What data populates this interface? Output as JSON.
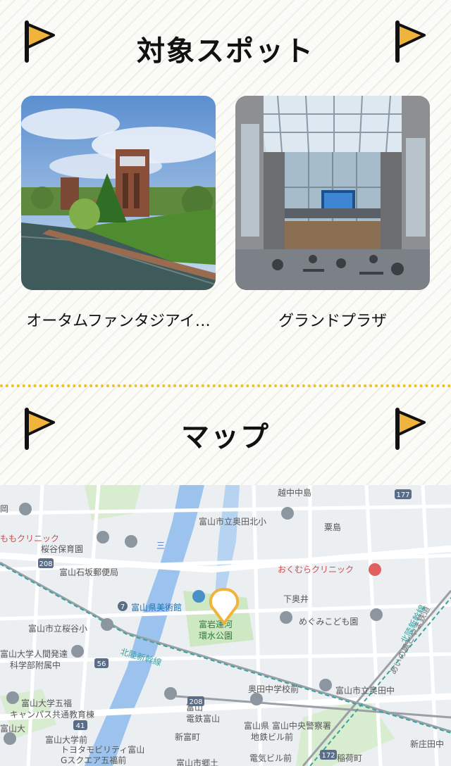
{
  "spots_section": {
    "title": "対象スポット"
  },
  "spots": [
    {
      "name": "オータムファンタジアイ…",
      "photo": "park-tower-canal"
    },
    {
      "name": "グランドプラザ",
      "photo": "glass-atrium-plaza"
    }
  ],
  "map_section": {
    "title": "マップ"
  },
  "map": {
    "pin_color": "#f0b43c",
    "labels": {
      "kosshi_nakajima": "越中中島",
      "toyama_okuda_kita_sho": "富山市立奥田北小",
      "awashima": "粟島",
      "momo_clinic": "ももクリニック",
      "sakuradani_hoikuen": "桜谷保育園",
      "okumura_clinic": "おくむらクリニック",
      "ishizakaguchi_post": "富山石坂郵便局",
      "toyama_art_museum": "富山県美術館",
      "shimo_okui": "下奥井",
      "fugan_canal": "富岩運河",
      "kansui_park": "環水公園",
      "megumi_kodomoen": "めぐみこども園",
      "sakuradani_sho": "富山市立桜谷小",
      "ningen_hattatsu": "富山大学人間発達",
      "kagakubu_fuzoku": "科学部附属中",
      "hokuriku_shinkansen": "北陸新幹線",
      "okudachu_mae": "奥田中学校前",
      "okuda_chu": "富山市立奥田中",
      "ainokaze_line": "あいの風とやま鉄道",
      "gofuku_campus_1": "富山大学五福",
      "gofuku_campus_2": "キャンパス共通教育棟",
      "toyama_station": "富山",
      "dentetsu_toyama": "電鉄富山",
      "police": "富山県 富山中央警察署",
      "toyama_univ_mae": "富山大学前",
      "toyota_mobility_1": "トヨタモビリティ富山",
      "toyota_mobility_2": "Gスクエア五福前",
      "shintomicho": "新富町",
      "chitetsu_building": "地鉄ビル前",
      "shin_shodai": "新庄田中",
      "toyama_daigaku": "富山大",
      "hokuriku_shinkansen_2": "北陸新幹線",
      "kawadaika": "三",
      "denki_building": "電気ビル前",
      "inarimachi": "稲荷町",
      "toyama_shigo": "富山市郷土",
      "sanno": "岡",
      "route_208": "208",
      "route_56": "56",
      "route_177": "177",
      "route_172": "172",
      "route_7": "7",
      "route_41": "41",
      "route_208b": "208"
    }
  }
}
